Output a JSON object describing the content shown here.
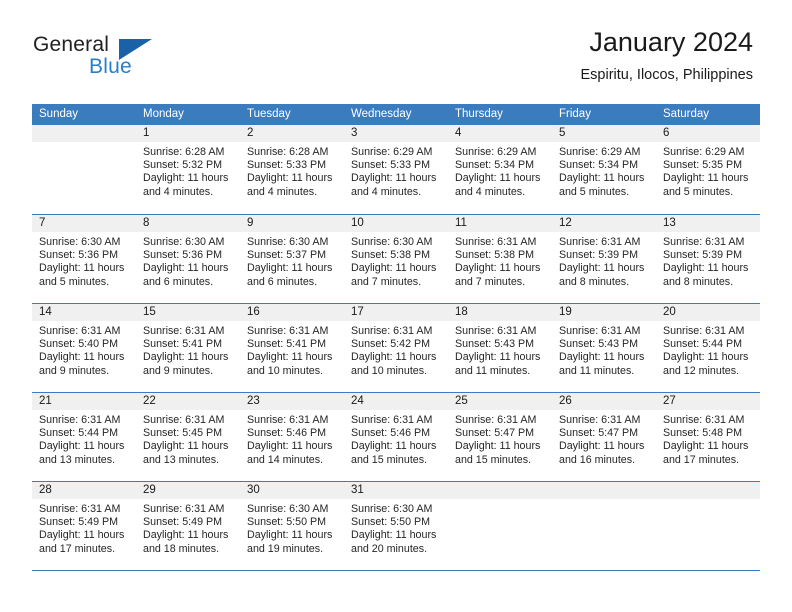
{
  "brand": {
    "name_top": "General",
    "name_bottom": "Blue",
    "triangle_icon": "triangle-icon",
    "accent_color": "#2a7fc9",
    "triangle_color": "#1a62a8"
  },
  "header": {
    "title": "January 2024",
    "subtitle": "Espiritu, Ilocos, Philippines"
  },
  "calendar": {
    "header_color": "#3b7cbe",
    "daynum_band_color": "#f0f0f0",
    "weekday_labels": [
      "Sunday",
      "Monday",
      "Tuesday",
      "Wednesday",
      "Thursday",
      "Friday",
      "Saturday"
    ],
    "weeks": [
      [
        {
          "day": "",
          "sunrise": "",
          "sunset": "",
          "daylight_line1": "",
          "daylight_line2": ""
        },
        {
          "day": "1",
          "sunrise": "Sunrise: 6:28 AM",
          "sunset": "Sunset: 5:32 PM",
          "daylight_line1": "Daylight: 11 hours",
          "daylight_line2": "and 4 minutes."
        },
        {
          "day": "2",
          "sunrise": "Sunrise: 6:28 AM",
          "sunset": "Sunset: 5:33 PM",
          "daylight_line1": "Daylight: 11 hours",
          "daylight_line2": "and 4 minutes."
        },
        {
          "day": "3",
          "sunrise": "Sunrise: 6:29 AM",
          "sunset": "Sunset: 5:33 PM",
          "daylight_line1": "Daylight: 11 hours",
          "daylight_line2": "and 4 minutes."
        },
        {
          "day": "4",
          "sunrise": "Sunrise: 6:29 AM",
          "sunset": "Sunset: 5:34 PM",
          "daylight_line1": "Daylight: 11 hours",
          "daylight_line2": "and 4 minutes."
        },
        {
          "day": "5",
          "sunrise": "Sunrise: 6:29 AM",
          "sunset": "Sunset: 5:34 PM",
          "daylight_line1": "Daylight: 11 hours",
          "daylight_line2": "and 5 minutes."
        },
        {
          "day": "6",
          "sunrise": "Sunrise: 6:29 AM",
          "sunset": "Sunset: 5:35 PM",
          "daylight_line1": "Daylight: 11 hours",
          "daylight_line2": "and 5 minutes."
        }
      ],
      [
        {
          "day": "7",
          "sunrise": "Sunrise: 6:30 AM",
          "sunset": "Sunset: 5:36 PM",
          "daylight_line1": "Daylight: 11 hours",
          "daylight_line2": "and 5 minutes."
        },
        {
          "day": "8",
          "sunrise": "Sunrise: 6:30 AM",
          "sunset": "Sunset: 5:36 PM",
          "daylight_line1": "Daylight: 11 hours",
          "daylight_line2": "and 6 minutes."
        },
        {
          "day": "9",
          "sunrise": "Sunrise: 6:30 AM",
          "sunset": "Sunset: 5:37 PM",
          "daylight_line1": "Daylight: 11 hours",
          "daylight_line2": "and 6 minutes."
        },
        {
          "day": "10",
          "sunrise": "Sunrise: 6:30 AM",
          "sunset": "Sunset: 5:38 PM",
          "daylight_line1": "Daylight: 11 hours",
          "daylight_line2": "and 7 minutes."
        },
        {
          "day": "11",
          "sunrise": "Sunrise: 6:31 AM",
          "sunset": "Sunset: 5:38 PM",
          "daylight_line1": "Daylight: 11 hours",
          "daylight_line2": "and 7 minutes."
        },
        {
          "day": "12",
          "sunrise": "Sunrise: 6:31 AM",
          "sunset": "Sunset: 5:39 PM",
          "daylight_line1": "Daylight: 11 hours",
          "daylight_line2": "and 8 minutes."
        },
        {
          "day": "13",
          "sunrise": "Sunrise: 6:31 AM",
          "sunset": "Sunset: 5:39 PM",
          "daylight_line1": "Daylight: 11 hours",
          "daylight_line2": "and 8 minutes."
        }
      ],
      [
        {
          "day": "14",
          "sunrise": "Sunrise: 6:31 AM",
          "sunset": "Sunset: 5:40 PM",
          "daylight_line1": "Daylight: 11 hours",
          "daylight_line2": "and 9 minutes."
        },
        {
          "day": "15",
          "sunrise": "Sunrise: 6:31 AM",
          "sunset": "Sunset: 5:41 PM",
          "daylight_line1": "Daylight: 11 hours",
          "daylight_line2": "and 9 minutes."
        },
        {
          "day": "16",
          "sunrise": "Sunrise: 6:31 AM",
          "sunset": "Sunset: 5:41 PM",
          "daylight_line1": "Daylight: 11 hours",
          "daylight_line2": "and 10 minutes."
        },
        {
          "day": "17",
          "sunrise": "Sunrise: 6:31 AM",
          "sunset": "Sunset: 5:42 PM",
          "daylight_line1": "Daylight: 11 hours",
          "daylight_line2": "and 10 minutes."
        },
        {
          "day": "18",
          "sunrise": "Sunrise: 6:31 AM",
          "sunset": "Sunset: 5:43 PM",
          "daylight_line1": "Daylight: 11 hours",
          "daylight_line2": "and 11 minutes."
        },
        {
          "day": "19",
          "sunrise": "Sunrise: 6:31 AM",
          "sunset": "Sunset: 5:43 PM",
          "daylight_line1": "Daylight: 11 hours",
          "daylight_line2": "and 11 minutes."
        },
        {
          "day": "20",
          "sunrise": "Sunrise: 6:31 AM",
          "sunset": "Sunset: 5:44 PM",
          "daylight_line1": "Daylight: 11 hours",
          "daylight_line2": "and 12 minutes."
        }
      ],
      [
        {
          "day": "21",
          "sunrise": "Sunrise: 6:31 AM",
          "sunset": "Sunset: 5:44 PM",
          "daylight_line1": "Daylight: 11 hours",
          "daylight_line2": "and 13 minutes."
        },
        {
          "day": "22",
          "sunrise": "Sunrise: 6:31 AM",
          "sunset": "Sunset: 5:45 PM",
          "daylight_line1": "Daylight: 11 hours",
          "daylight_line2": "and 13 minutes."
        },
        {
          "day": "23",
          "sunrise": "Sunrise: 6:31 AM",
          "sunset": "Sunset: 5:46 PM",
          "daylight_line1": "Daylight: 11 hours",
          "daylight_line2": "and 14 minutes."
        },
        {
          "day": "24",
          "sunrise": "Sunrise: 6:31 AM",
          "sunset": "Sunset: 5:46 PM",
          "daylight_line1": "Daylight: 11 hours",
          "daylight_line2": "and 15 minutes."
        },
        {
          "day": "25",
          "sunrise": "Sunrise: 6:31 AM",
          "sunset": "Sunset: 5:47 PM",
          "daylight_line1": "Daylight: 11 hours",
          "daylight_line2": "and 15 minutes."
        },
        {
          "day": "26",
          "sunrise": "Sunrise: 6:31 AM",
          "sunset": "Sunset: 5:47 PM",
          "daylight_line1": "Daylight: 11 hours",
          "daylight_line2": "and 16 minutes."
        },
        {
          "day": "27",
          "sunrise": "Sunrise: 6:31 AM",
          "sunset": "Sunset: 5:48 PM",
          "daylight_line1": "Daylight: 11 hours",
          "daylight_line2": "and 17 minutes."
        }
      ],
      [
        {
          "day": "28",
          "sunrise": "Sunrise: 6:31 AM",
          "sunset": "Sunset: 5:49 PM",
          "daylight_line1": "Daylight: 11 hours",
          "daylight_line2": "and 17 minutes."
        },
        {
          "day": "29",
          "sunrise": "Sunrise: 6:31 AM",
          "sunset": "Sunset: 5:49 PM",
          "daylight_line1": "Daylight: 11 hours",
          "daylight_line2": "and 18 minutes."
        },
        {
          "day": "30",
          "sunrise": "Sunrise: 6:30 AM",
          "sunset": "Sunset: 5:50 PM",
          "daylight_line1": "Daylight: 11 hours",
          "daylight_line2": "and 19 minutes."
        },
        {
          "day": "31",
          "sunrise": "Sunrise: 6:30 AM",
          "sunset": "Sunset: 5:50 PM",
          "daylight_line1": "Daylight: 11 hours",
          "daylight_line2": "and 20 minutes."
        },
        {
          "day": "",
          "sunrise": "",
          "sunset": "",
          "daylight_line1": "",
          "daylight_line2": ""
        },
        {
          "day": "",
          "sunrise": "",
          "sunset": "",
          "daylight_line1": "",
          "daylight_line2": ""
        },
        {
          "day": "",
          "sunrise": "",
          "sunset": "",
          "daylight_line1": "",
          "daylight_line2": ""
        }
      ]
    ]
  }
}
